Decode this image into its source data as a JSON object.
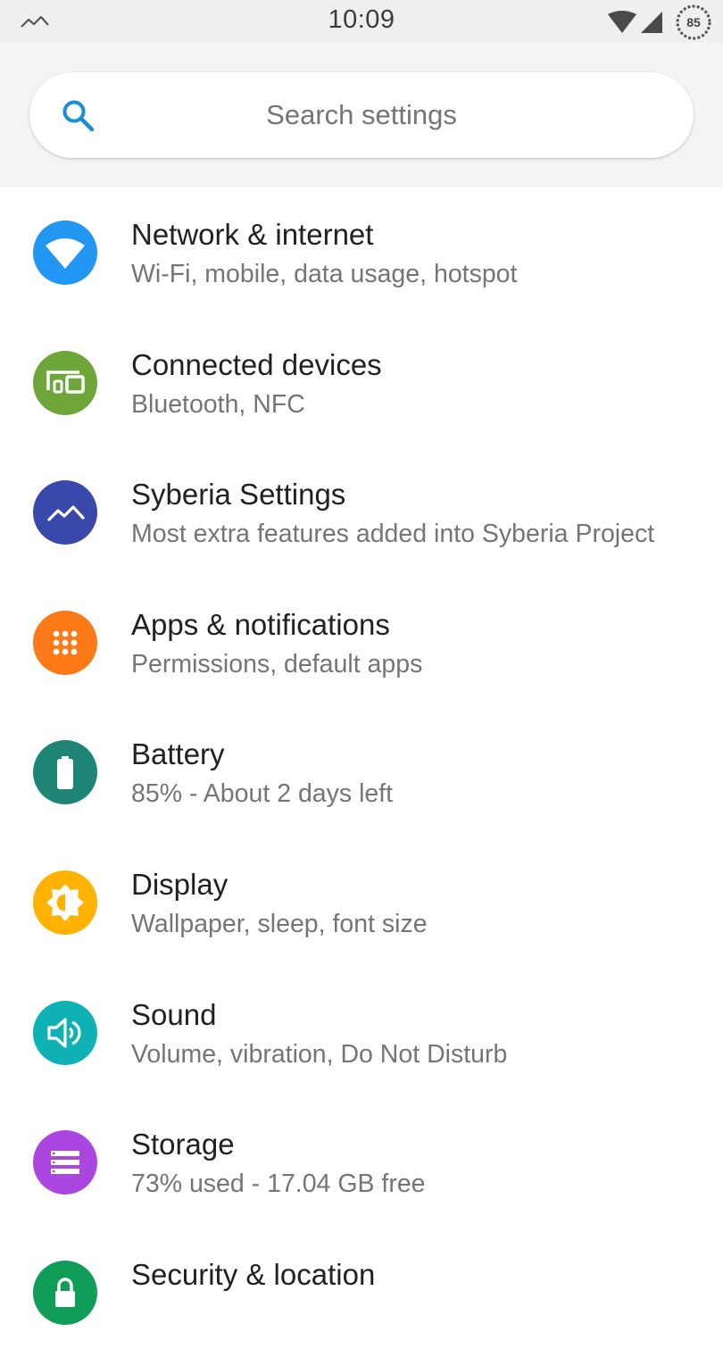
{
  "status_bar": {
    "time": "10:09",
    "battery_percent": "85",
    "left_icon": "syberia-notification-icon",
    "wifi_icon": "wifi-signal-icon",
    "cell_icon": "cell-signal-icon"
  },
  "search": {
    "placeholder": "Search settings",
    "icon": "search-icon",
    "accent": "#1a8fd8"
  },
  "settings": [
    {
      "title": "Network & internet",
      "subtitle": "Wi-Fi, mobile, data usage, hotspot",
      "icon": "wifi-icon",
      "color": "#2196f3"
    },
    {
      "title": "Connected devices",
      "subtitle": "Bluetooth, NFC",
      "icon": "devices-icon",
      "color": "#6ea639"
    },
    {
      "title": "Syberia Settings",
      "subtitle": "Most extra features added into Syberia Project",
      "icon": "syberia-icon",
      "color": "#3949ab"
    },
    {
      "title": "Apps & notifications",
      "subtitle": "Permissions, default apps",
      "icon": "apps-grid-icon",
      "color": "#fb7a17"
    },
    {
      "title": "Battery",
      "subtitle": "85% - About 2 days left",
      "icon": "battery-icon",
      "color": "#1e8576"
    },
    {
      "title": "Display",
      "subtitle": "Wallpaper, sleep, font size",
      "icon": "brightness-icon",
      "color": "#ffb300"
    },
    {
      "title": "Sound",
      "subtitle": "Volume, vibration, Do Not Disturb",
      "icon": "volume-icon",
      "color": "#0fb2b4"
    },
    {
      "title": "Storage",
      "subtitle": "73% used - 17.04 GB free",
      "icon": "storage-icon",
      "color": "#ab47e0"
    },
    {
      "title": "Security & location",
      "subtitle": "",
      "icon": "lock-icon",
      "color": "#0f9d58"
    }
  ]
}
